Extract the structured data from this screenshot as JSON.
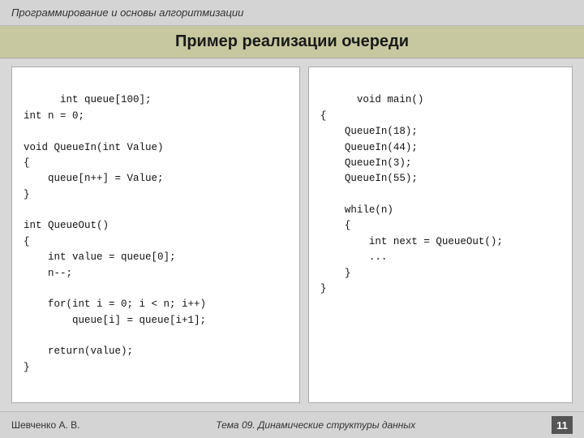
{
  "header": {
    "title": "Программирование и основы алгоритмизации"
  },
  "slide": {
    "title": "Пример реализации очереди"
  },
  "code_left": "int queue[100];\nint n = 0;\n\nvoid QueueIn(int Value)\n{\n    queue[n++] = Value;\n}\n\nint QueueOut()\n{\n    int value = queue[0];\n    n--;\n\n    for(int i = 0; i < n; i++)\n        queue[i] = queue[i+1];\n\n    return(value);\n}",
  "code_right": "void main()\n{\n    QueueIn(18);\n    QueueIn(44);\n    QueueIn(3);\n    QueueIn(55);\n\n    while(n)\n    {\n        int next = QueueOut();\n        ...\n    }\n}",
  "footer": {
    "author": "Шевченко А. В.",
    "topic": "Тема 09. Динамические структуры данных",
    "page_number": "11"
  }
}
